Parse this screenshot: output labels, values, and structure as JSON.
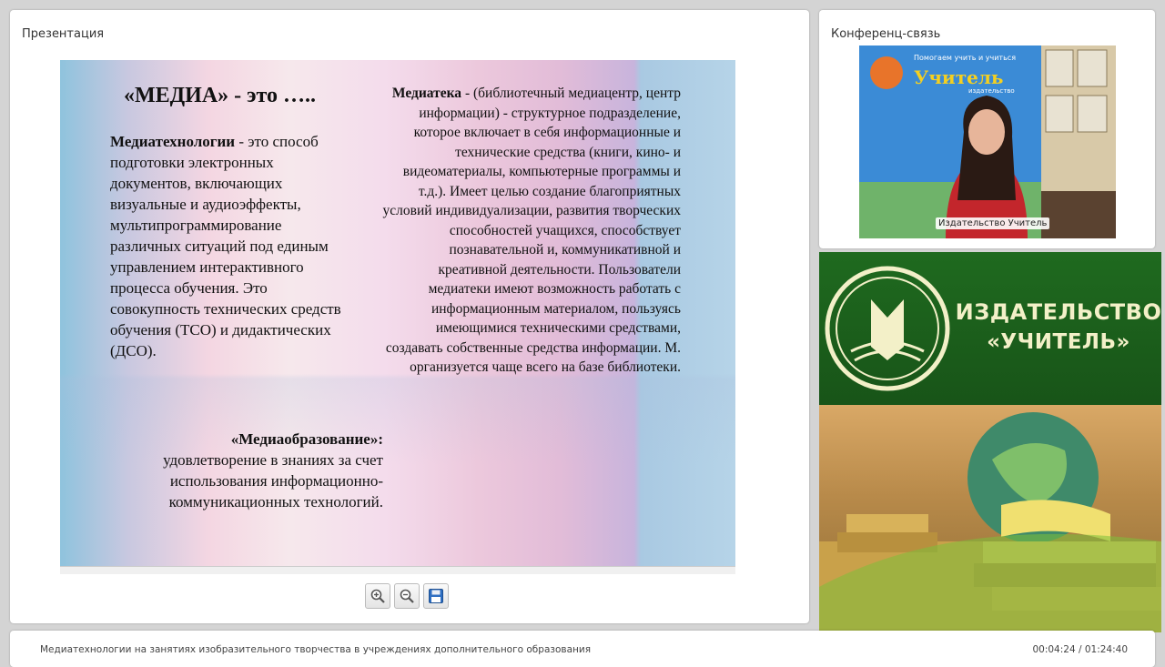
{
  "panels": {
    "presentation_title": "Презентация",
    "conference_title": "Конференц-связь"
  },
  "slide": {
    "heading": "«МЕДИА» - это …..",
    "mediatech_term": "Медиатехнологии",
    "mediatech_text": " - это способ подготовки электронных документов, включающих визуальные и аудиоэффекты, мультипрограммирование различных ситуаций под единым управлением интерактивного процесса обучения. Это совокупность технических средств обучения (ТСО) и дидактических (ДСО).",
    "mediaedu_term": "«Медиаобразование»:",
    "mediaedu_text": "удовлетворение в знаниях за счет использования информационно-коммуникационных технологий.",
    "mediateka_term": "Медиатека",
    "mediateka_text": " - (библиотечный медиацентр, центр информации) - структурное подразделение, которое включает в себя информационные и технические средства (книги, кино- и видеоматериалы, компьютерные программы и т.д.). Имеет целью создание благоприятных условий индивидуализации, развития творческих способностей учащихся, способствует познавательной и, коммуникативной и креативной деятельности. Пользователи медиатеки имеют возможность работать с информационным материалом, пользуясь имеющимися техническими средствами, создавать собственные средства информации. М. организуется чаще всего на базе библиотеки."
  },
  "toolbar": {
    "zoom_in_icon": "zoom-in-icon",
    "zoom_out_icon": "zoom-out-icon",
    "save_icon": "floppy-disk-icon"
  },
  "video": {
    "participant_label": "Издательство Учитель",
    "banner_text_line1": "Помогаем учить и учиться",
    "banner_brand": "Учитель",
    "banner_small": "издательство"
  },
  "brand": {
    "name_line1": "ИЗДАТЕЛЬСТВО",
    "name_line2": "«УЧИТЕЛЬ»",
    "accent_color": "#1b5e1b",
    "text_color": "#f3f0c8"
  },
  "footer": {
    "title": "Медиатехнологии на занятиях изобразительного творчества в учреждениях дополнительного образования",
    "time": "00:04:24 / 01:24:40"
  }
}
